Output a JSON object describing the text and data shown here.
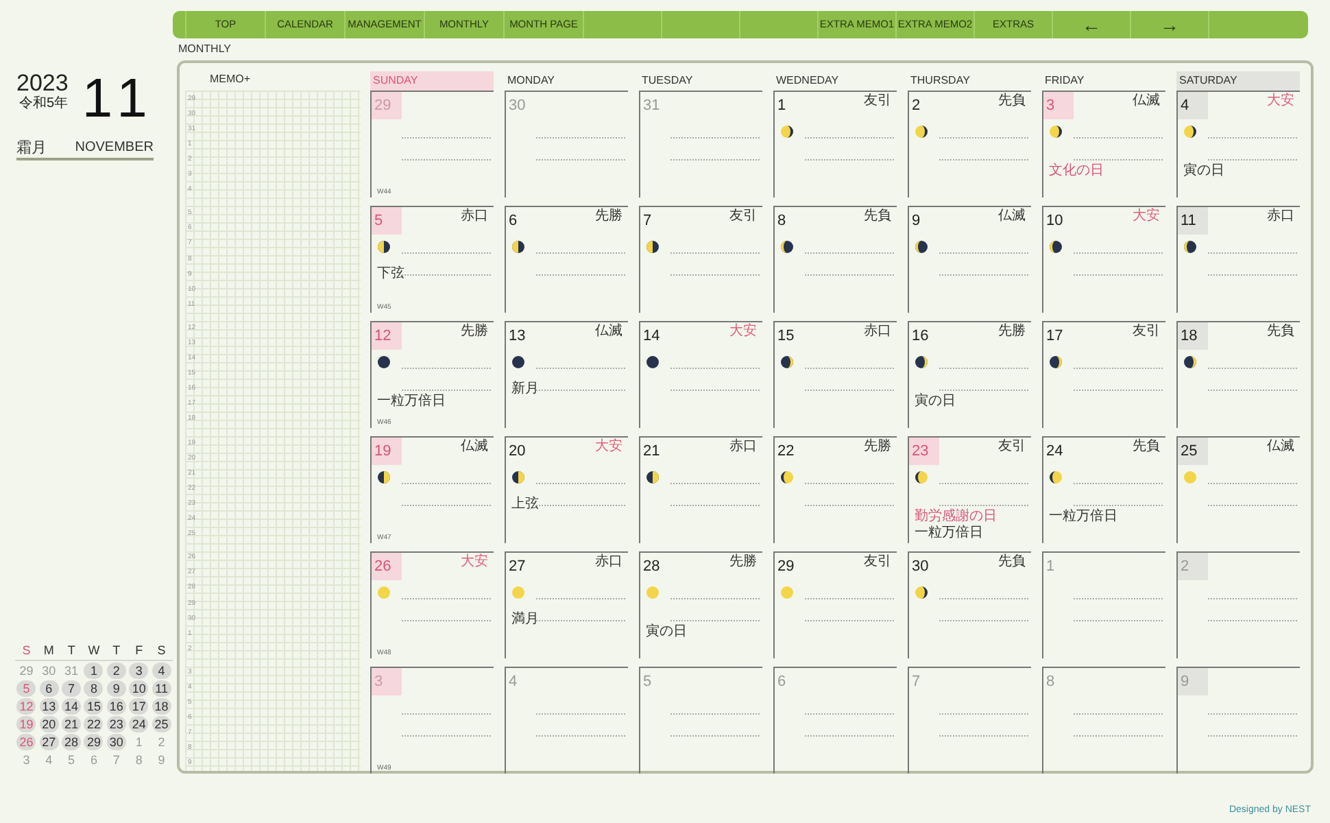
{
  "nav": {
    "left": [
      "TOP",
      "CALENDAR",
      "MANAGEMENT",
      "MONTHLY",
      "MONTH PAGE"
    ],
    "right": [
      "EXTRA MEMO1",
      "EXTRA MEMO2",
      "EXTRAS"
    ],
    "arrows": [
      "←",
      "→"
    ]
  },
  "section_label": "MONTHLY",
  "header": {
    "year": "2023",
    "era": "令和5年",
    "month": "11",
    "month_jp": "霜月",
    "month_en": "NOVEMBER"
  },
  "memo": {
    "title": "MEMO+",
    "numbers": [
      [
        "29",
        "30",
        "31",
        "1",
        "2",
        "3",
        "4"
      ],
      [
        "5",
        "6",
        "7",
        "8",
        "9",
        "10",
        "11"
      ],
      [
        "12",
        "13",
        "14",
        "15",
        "16",
        "17",
        "18"
      ],
      [
        "19",
        "20",
        "21",
        "22",
        "23",
        "24",
        "25"
      ],
      [
        "26",
        "27",
        "28",
        "29",
        "30",
        "1",
        "2"
      ],
      [
        "3",
        "4",
        "5",
        "6",
        "7",
        "8",
        "9"
      ]
    ]
  },
  "weekdays": [
    "SUNDAY",
    "MONDAY",
    "TUESDAY",
    "WEDNEDAY",
    "THURSDAY",
    "FRIDAY",
    "SATURDAY"
  ],
  "weeks": [
    {
      "week": "W44",
      "days": [
        {
          "day": "29",
          "in_month": false
        },
        {
          "day": "30",
          "in_month": false,
          "holiday": false
        },
        {
          "day": "31",
          "in_month": false,
          "holiday": false
        },
        {
          "day": "1",
          "in_month": true,
          "holiday": false,
          "rokuyo": "友引",
          "rokuyo_highlight": false,
          "moon": {
            "kind": "waning-gibbous"
          }
        },
        {
          "day": "2",
          "in_month": true,
          "holiday": false,
          "rokuyo": "先負",
          "rokuyo_highlight": false,
          "moon": {
            "kind": "waning-gibbous"
          }
        },
        {
          "day": "3",
          "in_month": true,
          "holiday": true,
          "rokuyo": "仏滅",
          "rokuyo_highlight": false,
          "moon": {
            "kind": "waning-gibbous"
          },
          "notes": [
            {
              "kind": "holiday",
              "text": "文化の日"
            }
          ]
        },
        {
          "day": "4",
          "in_month": true,
          "rokuyo": "大安",
          "rokuyo_highlight": true,
          "moon": {
            "kind": "waning-gibbous"
          },
          "notes": [
            {
              "kind": "event",
              "text": "寅の日"
            }
          ]
        }
      ]
    },
    {
      "week": "W45",
      "days": [
        {
          "day": "5",
          "in_month": true,
          "rokuyo": "赤口",
          "rokuyo_highlight": false,
          "moon": {
            "kind": "last-quarter"
          },
          "notes": [
            {
              "kind": "moon",
              "text": "下弦"
            }
          ]
        },
        {
          "day": "6",
          "in_month": true,
          "holiday": false,
          "rokuyo": "先勝",
          "rokuyo_highlight": false,
          "moon": {
            "kind": "last-quarter"
          }
        },
        {
          "day": "7",
          "in_month": true,
          "holiday": false,
          "rokuyo": "友引",
          "rokuyo_highlight": false,
          "moon": {
            "kind": "last-quarter"
          }
        },
        {
          "day": "8",
          "in_month": true,
          "holiday": false,
          "rokuyo": "先負",
          "rokuyo_highlight": false,
          "moon": {
            "kind": "waning-crescent"
          }
        },
        {
          "day": "9",
          "in_month": true,
          "holiday": false,
          "rokuyo": "仏滅",
          "rokuyo_highlight": false,
          "moon": {
            "kind": "waning-crescent"
          }
        },
        {
          "day": "10",
          "in_month": true,
          "holiday": false,
          "rokuyo": "大安",
          "rokuyo_highlight": true,
          "moon": {
            "kind": "waning-crescent"
          }
        },
        {
          "day": "11",
          "in_month": true,
          "rokuyo": "赤口",
          "rokuyo_highlight": false,
          "moon": {
            "kind": "waning-crescent"
          }
        }
      ]
    },
    {
      "week": "W46",
      "days": [
        {
          "day": "12",
          "in_month": true,
          "rokuyo": "先勝",
          "rokuyo_highlight": false,
          "moon": {
            "kind": "new"
          },
          "notes": [
            {
              "kind": "event",
              "text": "一粒万倍日"
            }
          ]
        },
        {
          "day": "13",
          "in_month": true,
          "holiday": false,
          "rokuyo": "仏滅",
          "rokuyo_highlight": false,
          "moon": {
            "kind": "new"
          },
          "notes": [
            {
              "kind": "moon",
              "text": "新月"
            }
          ]
        },
        {
          "day": "14",
          "in_month": true,
          "holiday": false,
          "rokuyo": "大安",
          "rokuyo_highlight": true,
          "moon": {
            "kind": "new"
          }
        },
        {
          "day": "15",
          "in_month": true,
          "holiday": false,
          "rokuyo": "赤口",
          "rokuyo_highlight": false,
          "moon": {
            "kind": "waxing-crescent"
          }
        },
        {
          "day": "16",
          "in_month": true,
          "holiday": false,
          "rokuyo": "先勝",
          "rokuyo_highlight": false,
          "moon": {
            "kind": "waxing-crescent"
          },
          "notes": [
            {
              "kind": "event",
              "text": "寅の日"
            }
          ]
        },
        {
          "day": "17",
          "in_month": true,
          "holiday": false,
          "rokuyo": "友引",
          "rokuyo_highlight": false,
          "moon": {
            "kind": "waxing-crescent"
          }
        },
        {
          "day": "18",
          "in_month": true,
          "rokuyo": "先負",
          "rokuyo_highlight": false,
          "moon": {
            "kind": "waxing-crescent"
          }
        }
      ]
    },
    {
      "week": "W47",
      "days": [
        {
          "day": "19",
          "in_month": true,
          "rokuyo": "仏滅",
          "rokuyo_highlight": false,
          "moon": {
            "kind": "first-quarter"
          }
        },
        {
          "day": "20",
          "in_month": true,
          "holiday": false,
          "rokuyo": "大安",
          "rokuyo_highlight": true,
          "moon": {
            "kind": "first-quarter"
          },
          "notes": [
            {
              "kind": "moon",
              "text": "上弦"
            }
          ]
        },
        {
          "day": "21",
          "in_month": true,
          "holiday": false,
          "rokuyo": "赤口",
          "rokuyo_highlight": false,
          "moon": {
            "kind": "first-quarter"
          }
        },
        {
          "day": "22",
          "in_month": true,
          "holiday": false,
          "rokuyo": "先勝",
          "rokuyo_highlight": false,
          "moon": {
            "kind": "waxing-gibbous"
          }
        },
        {
          "day": "23",
          "in_month": true,
          "holiday": true,
          "rokuyo": "友引",
          "rokuyo_highlight": false,
          "moon": {
            "kind": "waxing-gibbous"
          },
          "notes": [
            {
              "kind": "holiday",
              "text": "勤労感謝の日"
            },
            {
              "kind": "event",
              "text": "一粒万倍日"
            }
          ]
        },
        {
          "day": "24",
          "in_month": true,
          "holiday": false,
          "rokuyo": "先負",
          "rokuyo_highlight": false,
          "moon": {
            "kind": "waxing-gibbous"
          },
          "notes": [
            {
              "kind": "event",
              "text": "一粒万倍日"
            }
          ]
        },
        {
          "day": "25",
          "in_month": true,
          "rokuyo": "仏滅",
          "rokuyo_highlight": false,
          "moon": {
            "kind": "full"
          }
        }
      ]
    },
    {
      "week": "W48",
      "days": [
        {
          "day": "26",
          "in_month": true,
          "rokuyo": "大安",
          "rokuyo_highlight": true,
          "moon": {
            "kind": "full"
          }
        },
        {
          "day": "27",
          "in_month": true,
          "holiday": false,
          "rokuyo": "赤口",
          "rokuyo_highlight": false,
          "moon": {
            "kind": "full"
          },
          "notes": [
            {
              "kind": "moon",
              "text": "満月"
            }
          ]
        },
        {
          "day": "28",
          "in_month": true,
          "holiday": false,
          "rokuyo": "先勝",
          "rokuyo_highlight": false,
          "moon": {
            "kind": "full"
          },
          "notes": [
            {
              "kind": "event",
              "text": "寅の日"
            }
          ]
        },
        {
          "day": "29",
          "in_month": true,
          "holiday": false,
          "rokuyo": "友引",
          "rokuyo_highlight": false,
          "moon": {
            "kind": "full"
          }
        },
        {
          "day": "30",
          "in_month": true,
          "holiday": false,
          "rokuyo": "先負",
          "rokuyo_highlight": false,
          "moon": {
            "kind": "waning-gibbous"
          }
        },
        {
          "day": "1",
          "in_month": false,
          "holiday": false
        },
        {
          "day": "2",
          "in_month": false
        }
      ]
    },
    {
      "week": "W49",
      "days": [
        {
          "day": "3",
          "in_month": false
        },
        {
          "day": "4",
          "in_month": false,
          "holiday": false
        },
        {
          "day": "5",
          "in_month": false,
          "holiday": false
        },
        {
          "day": "6",
          "in_month": false,
          "holiday": false
        },
        {
          "day": "7",
          "in_month": false,
          "holiday": false
        },
        {
          "day": "8",
          "in_month": false,
          "holiday": false
        },
        {
          "day": "9",
          "in_month": false
        }
      ]
    }
  ],
  "mini_calendar": {
    "weekdays": [
      "S",
      "M",
      "T",
      "W",
      "T",
      "F",
      "S"
    ],
    "days": [
      {
        "day": "29",
        "in_month": false
      },
      {
        "day": "30",
        "in_month": false
      },
      {
        "day": "31",
        "in_month": false
      },
      {
        "day": "1",
        "in_month": true
      },
      {
        "day": "2",
        "in_month": true
      },
      {
        "day": "3",
        "in_month": true
      },
      {
        "day": "4",
        "in_month": true
      },
      {
        "day": "5",
        "in_month": true
      },
      {
        "day": "6",
        "in_month": true
      },
      {
        "day": "7",
        "in_month": true
      },
      {
        "day": "8",
        "in_month": true
      },
      {
        "day": "9",
        "in_month": true
      },
      {
        "day": "10",
        "in_month": true
      },
      {
        "day": "11",
        "in_month": true
      },
      {
        "day": "12",
        "in_month": true
      },
      {
        "day": "13",
        "in_month": true
      },
      {
        "day": "14",
        "in_month": true
      },
      {
        "day": "15",
        "in_month": true
      },
      {
        "day": "16",
        "in_month": true
      },
      {
        "day": "17",
        "in_month": true
      },
      {
        "day": "18",
        "in_month": true
      },
      {
        "day": "19",
        "in_month": true
      },
      {
        "day": "20",
        "in_month": true
      },
      {
        "day": "21",
        "in_month": true
      },
      {
        "day": "22",
        "in_month": true
      },
      {
        "day": "23",
        "in_month": true
      },
      {
        "day": "24",
        "in_month": true
      },
      {
        "day": "25",
        "in_month": true
      },
      {
        "day": "26",
        "in_month": true
      },
      {
        "day": "27",
        "in_month": true
      },
      {
        "day": "28",
        "in_month": true
      },
      {
        "day": "29",
        "in_month": true
      },
      {
        "day": "30",
        "in_month": true
      },
      {
        "day": "1",
        "in_month": false
      },
      {
        "day": "2",
        "in_month": false
      },
      {
        "day": "3",
        "in_month": false
      },
      {
        "day": "4",
        "in_month": false
      },
      {
        "day": "5",
        "in_month": false
      },
      {
        "day": "6",
        "in_month": false
      },
      {
        "day": "7",
        "in_month": false
      },
      {
        "day": "8",
        "in_month": false
      },
      {
        "day": "9",
        "in_month": false
      }
    ]
  },
  "credit": "Designed by NEST"
}
